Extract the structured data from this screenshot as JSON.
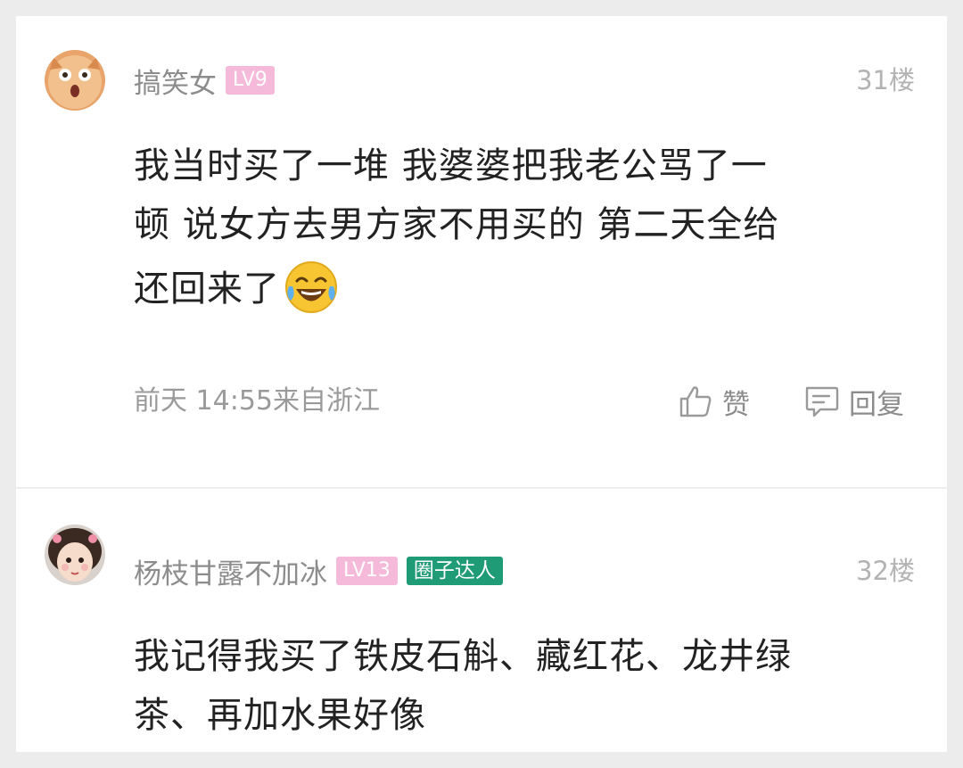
{
  "comments": [
    {
      "username": "搞笑女",
      "level": "LV9",
      "floor": "31楼",
      "lines": [
        "我当时买了一堆 我婆婆把我老公骂了一",
        "顿 说女方去男方家不用买的 第二天全给",
        "还回来了"
      ],
      "emoji": "laughing-tears-emoji",
      "time": "前天 14:55来自浙江",
      "like_label": "赞",
      "reply_label": "回复"
    },
    {
      "username": "杨枝甘露不加冰",
      "level": "LV13",
      "badge": "圈子达人",
      "floor": "32楼",
      "lines": [
        "我记得我买了铁皮石斛、藏红花、龙井绿",
        "茶、再加水果好像"
      ]
    }
  ],
  "colors": {
    "level_badge": "#f5b9d9",
    "expert_badge": "#1f9b76",
    "username": "#8c8c8c",
    "body_text": "#222222"
  }
}
